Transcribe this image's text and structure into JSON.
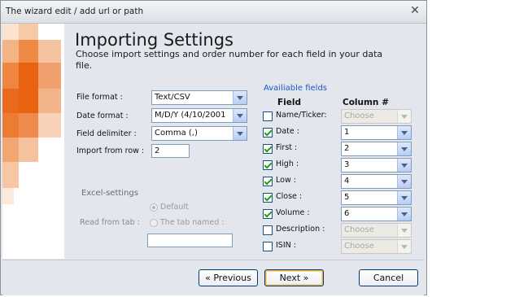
{
  "window": {
    "title": "The wizard edit / add url or path",
    "close_glyph": "✕"
  },
  "header": {
    "title": "Importing Settings",
    "subtitle": "Choose import settings and order number for each field in your data file."
  },
  "settings": {
    "file_format": {
      "label": "File format :",
      "value": "Text/CSV"
    },
    "date_format": {
      "label": "Date format  :",
      "value": "M/D/Y (4/10/2001"
    },
    "field_delimiter": {
      "label": "Field delimiter  :",
      "value": "Comma (,)"
    },
    "import_from_row": {
      "label": "Import from row :",
      "value": "2"
    }
  },
  "excel": {
    "title": "Excel-settings",
    "read_from_tab_label": "Read from tab :",
    "default_label": "Default",
    "tab_named_label": "The tab named :",
    "tab_name_value": ""
  },
  "fields": {
    "title": "Availiable fields",
    "field_header": "Field",
    "column_header": "Column #",
    "items": [
      {
        "label": "Name/Ticker:",
        "checked": false,
        "column": "Choose"
      },
      {
        "label": "Date :",
        "checked": true,
        "column": "1"
      },
      {
        "label": "First :",
        "checked": true,
        "column": "2"
      },
      {
        "label": "High :",
        "checked": true,
        "column": "3"
      },
      {
        "label": "Low :",
        "checked": true,
        "column": "4"
      },
      {
        "label": "Close :",
        "checked": true,
        "column": "5"
      },
      {
        "label": "Volume :",
        "checked": true,
        "column": "6"
      },
      {
        "label": "Description :",
        "checked": false,
        "column": "Choose"
      },
      {
        "label": "ISIN :",
        "checked": false,
        "column": "Choose"
      }
    ]
  },
  "buttons": {
    "previous": "« Previous",
    "next": "Next »",
    "cancel": "Cancel"
  },
  "colors": {
    "accent": "#e8620f",
    "link_blue": "#1c58c8",
    "check_green": "#21a121"
  }
}
